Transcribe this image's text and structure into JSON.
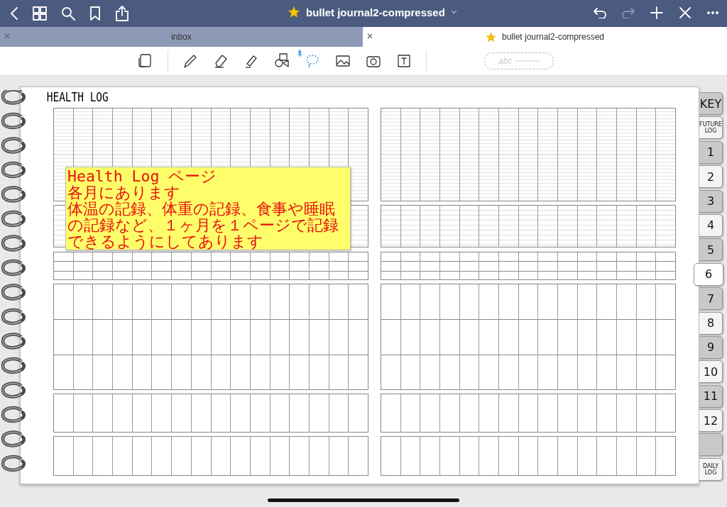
{
  "top_bar": {
    "title": "bullet journal2-compressed",
    "redo": {
      "disabled": true
    }
  },
  "doc_tabs": [
    {
      "label": "inbox",
      "selected": false
    },
    {
      "label": "bullet journal2-compressed",
      "selected": true
    }
  ],
  "tools": [
    {
      "kind": "page",
      "selected": false
    },
    {
      "kind": "pen",
      "selected": false
    },
    {
      "kind": "eraser",
      "selected": false
    },
    {
      "kind": "highlighter",
      "selected": false
    },
    {
      "kind": "shapes",
      "selected": false
    },
    {
      "kind": "lasso",
      "selected": true
    },
    {
      "kind": "image",
      "selected": false
    },
    {
      "kind": "camera",
      "selected": false
    },
    {
      "kind": "text",
      "selected": false
    }
  ],
  "ink_preview": "abc ~~~~~",
  "page": {
    "title": "HEALTH LOG",
    "note_lines": [
      "Health Log ページ",
      "各月にあります",
      "体温の記録、体重の記録、食事や睡眠",
      "の記録など、１ヶ月を１ページで記録",
      "できるようにしてあります"
    ]
  },
  "section_tabs": [
    {
      "label": "KEY",
      "selected": false,
      "color": "#c9c9c9"
    },
    {
      "label": "FUTURE LOG",
      "selected": false,
      "color": "#f4f4f4"
    },
    {
      "label": "1",
      "selected": false,
      "color": "#c9c9c9"
    },
    {
      "label": "2",
      "selected": false,
      "color": "#f4f4f4"
    },
    {
      "label": "3",
      "selected": false,
      "color": "#c9c9c9"
    },
    {
      "label": "4",
      "selected": false,
      "color": "#f4f4f4"
    },
    {
      "label": "5",
      "selected": false,
      "color": "#c9c9c9"
    },
    {
      "label": "6",
      "selected": true,
      "color": "#ffffff"
    },
    {
      "label": "7",
      "selected": false,
      "color": "#c9c9c9"
    },
    {
      "label": "8",
      "selected": false,
      "color": "#f4f4f4"
    },
    {
      "label": "9",
      "selected": false,
      "color": "#c9c9c9"
    },
    {
      "label": "10",
      "selected": false,
      "color": "#f4f4f4"
    },
    {
      "label": "11",
      "selected": false,
      "color": "#c9c9c9"
    },
    {
      "label": "12",
      "selected": false,
      "color": "#f4f4f4"
    },
    {
      "selected": false,
      "color": "#c9c9c9"
    },
    {
      "label": "DAILY LOG",
      "selected": false,
      "color": "#f4f4f4"
    }
  ]
}
